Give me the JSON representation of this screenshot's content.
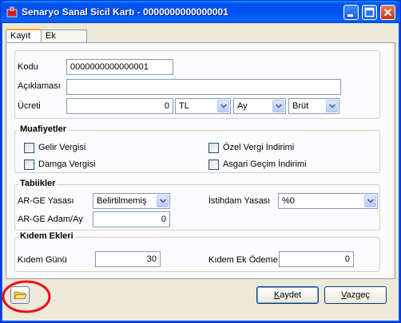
{
  "window": {
    "title": "Senaryo Sanal Sicil Kartı - 0000000000000001",
    "controls": [
      "minimize-icon",
      "maximize-icon",
      "close-icon"
    ]
  },
  "tabs": [
    {
      "label": "Kayıt",
      "active": true
    },
    {
      "label": "Ek Haklar",
      "active": false
    }
  ],
  "main": {
    "kodu_label": "Kodu",
    "kodu_value": "0000000000000001",
    "aciklama_label": "Açıklaması",
    "aciklama_value": "",
    "ucret_label": "Ücreti",
    "ucret_value": "0",
    "currency": "TL",
    "period": "Ay",
    "gross": "Brüt"
  },
  "muafiyetler": {
    "title": "Muafiyetler",
    "gelir": "Gelir Vergisi",
    "damga": "Damga Vergisi",
    "ozel": "Özel Vergi İndirimi",
    "asgari": "Asgari Geçim İndirimi"
  },
  "tabiikler": {
    "title": "Tabiikler",
    "arge_yasasi_label": "AR-GE Yasası",
    "arge_yasasi_value": "Belirtilmemiş",
    "istihdam_label": "İstihdam Yasası",
    "istihdam_value": "%0",
    "arge_adam_label": "AR-GE Adam/Ay",
    "arge_adam_value": "0"
  },
  "kidem": {
    "title": "Kıdem Ekleri",
    "gunu_label": "Kıdem Günü",
    "gunu_value": "30",
    "ek_odeme_label": "Kıdem Ek Ödeme",
    "ek_odeme_value": "0"
  },
  "footer": {
    "folder_icon": "folder-open-icon",
    "save_prefix": "",
    "save_hotkey": "K",
    "save_rest": "aydet",
    "cancel_hotkey": "V",
    "cancel_rest": "azgeç"
  },
  "colors": {
    "titlebar": "#0053ee",
    "highlight_ring": "#e8101c",
    "window_bg": "#ece9d8"
  }
}
